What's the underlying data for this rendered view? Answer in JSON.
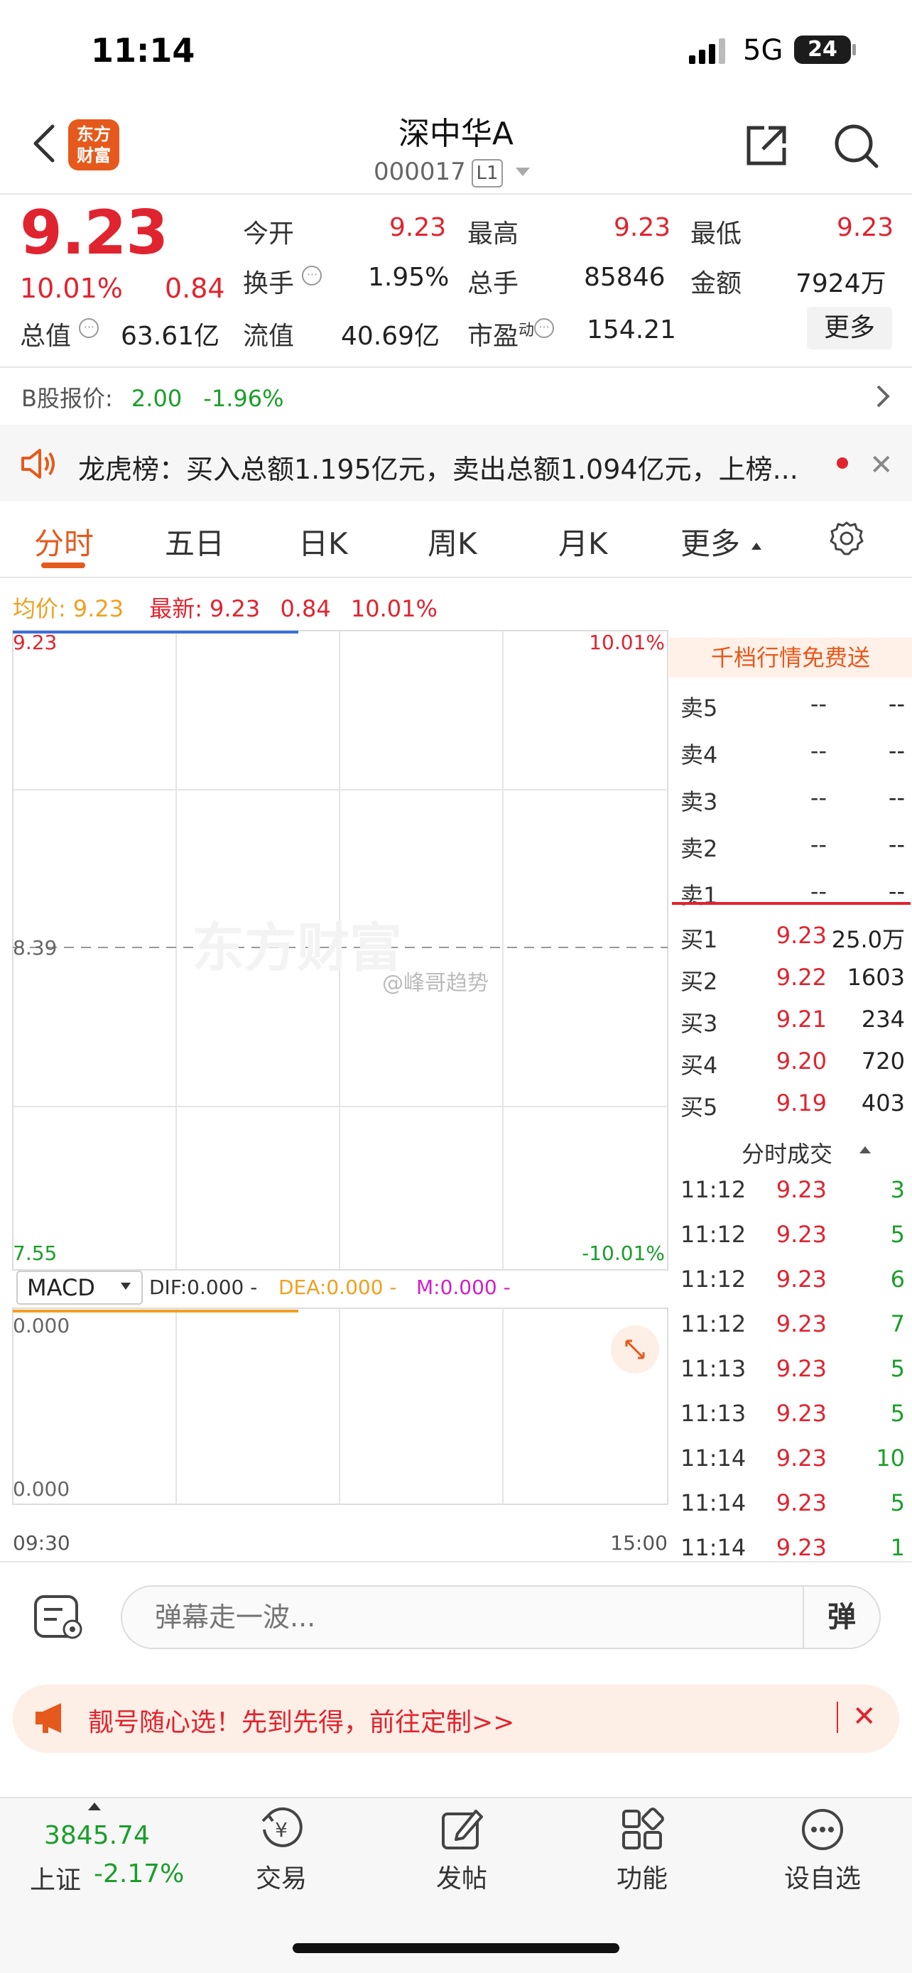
{
  "status_bar": {
    "time": "11:14",
    "network": "5G",
    "battery": "24"
  },
  "header": {
    "logo": "东方\n财富",
    "name": "深中华A",
    "code": "000017",
    "level_badge": "L1"
  },
  "quote": {
    "price": "9.23",
    "change_pct": "10.01%",
    "change_amt": "0.84",
    "rows": [
      [
        {
          "label": "今开",
          "value": "9.23"
        },
        {
          "label": "最高",
          "value": "9.23"
        },
        {
          "label": "最低",
          "value": "9.23"
        }
      ],
      [
        {
          "label": "换手",
          "value": "1.95%"
        },
        {
          "label": "总手",
          "value": "85846"
        },
        {
          "label": "金额",
          "value": "7924万"
        }
      ],
      [
        {
          "label": "总值",
          "value": "63.61亿"
        },
        {
          "label": "流值",
          "value": "40.69亿"
        },
        {
          "label": "市盈",
          "sup": "动",
          "value": "154.21"
        }
      ]
    ],
    "more_label": "更多"
  },
  "b_share": {
    "label": "B股报价:",
    "price": "2.00",
    "change": "-1.96%"
  },
  "notice": {
    "text": "龙虎榜：买入总额1.195亿元，卖出总额1.094亿元，上榜..."
  },
  "tabs": [
    "分时",
    "五日",
    "日K",
    "周K",
    "月K",
    "更多"
  ],
  "summary": {
    "avg_label": "均价:",
    "avg": "9.23",
    "last_label": "最新:",
    "last": "9.23",
    "chg": "0.84",
    "pct": "10.01%"
  },
  "chart": {
    "y_top": "9.23",
    "y_mid": "8.39",
    "y_bot": "7.55",
    "pct_top": "10.01%",
    "pct_bot": "-10.01%",
    "watermark": "东方财富",
    "weibo_tag": "@峰哥趋势",
    "macd_label": "MACD",
    "dif": "DIF:0.000 -",
    "dea": "DEA:0.000 -",
    "m": "M:0.000 -",
    "macd_top": "0.000",
    "macd_bot": "0.000",
    "time_start": "09:30",
    "time_end": "15:00"
  },
  "order_book": {
    "header": "千档行情免费送",
    "sells": [
      {
        "label": "卖5",
        "price": "--",
        "vol": "--"
      },
      {
        "label": "卖4",
        "price": "--",
        "vol": "--"
      },
      {
        "label": "卖3",
        "price": "--",
        "vol": "--"
      },
      {
        "label": "卖2",
        "price": "--",
        "vol": "--"
      },
      {
        "label": "卖1",
        "price": "--",
        "vol": "--"
      }
    ],
    "buys": [
      {
        "label": "买1",
        "price": "9.23",
        "vol": "25.0万"
      },
      {
        "label": "买2",
        "price": "9.22",
        "vol": "1603"
      },
      {
        "label": "买3",
        "price": "9.21",
        "vol": "234"
      },
      {
        "label": "买4",
        "price": "9.20",
        "vol": "720"
      },
      {
        "label": "买5",
        "price": "9.19",
        "vol": "403"
      }
    ],
    "ticks_title": "分时成交",
    "ticks": [
      {
        "time": "11:12",
        "price": "9.23",
        "vol": "3"
      },
      {
        "time": "11:12",
        "price": "9.23",
        "vol": "5"
      },
      {
        "time": "11:12",
        "price": "9.23",
        "vol": "6"
      },
      {
        "time": "11:12",
        "price": "9.23",
        "vol": "7"
      },
      {
        "time": "11:13",
        "price": "9.23",
        "vol": "5"
      },
      {
        "time": "11:13",
        "price": "9.23",
        "vol": "5"
      },
      {
        "time": "11:14",
        "price": "9.23",
        "vol": "10"
      },
      {
        "time": "11:14",
        "price": "9.23",
        "vol": "5"
      },
      {
        "time": "11:14",
        "price": "9.23",
        "vol": "1"
      }
    ]
  },
  "comment": {
    "placeholder": "弹幕走一波...",
    "button": "弹"
  },
  "promo": {
    "text": "靓号随心选！先到先得，前往定制>>"
  },
  "bottom_nav": {
    "index_value": "3845.74",
    "index_name": "上证",
    "index_change": "-2.17%",
    "items": [
      "交易",
      "发帖",
      "功能",
      "设自选"
    ]
  },
  "colors": {
    "up": "#e0242f",
    "down": "#1a9e2a",
    "brand": "#e55a1c",
    "avg_line": "#f0a020"
  }
}
